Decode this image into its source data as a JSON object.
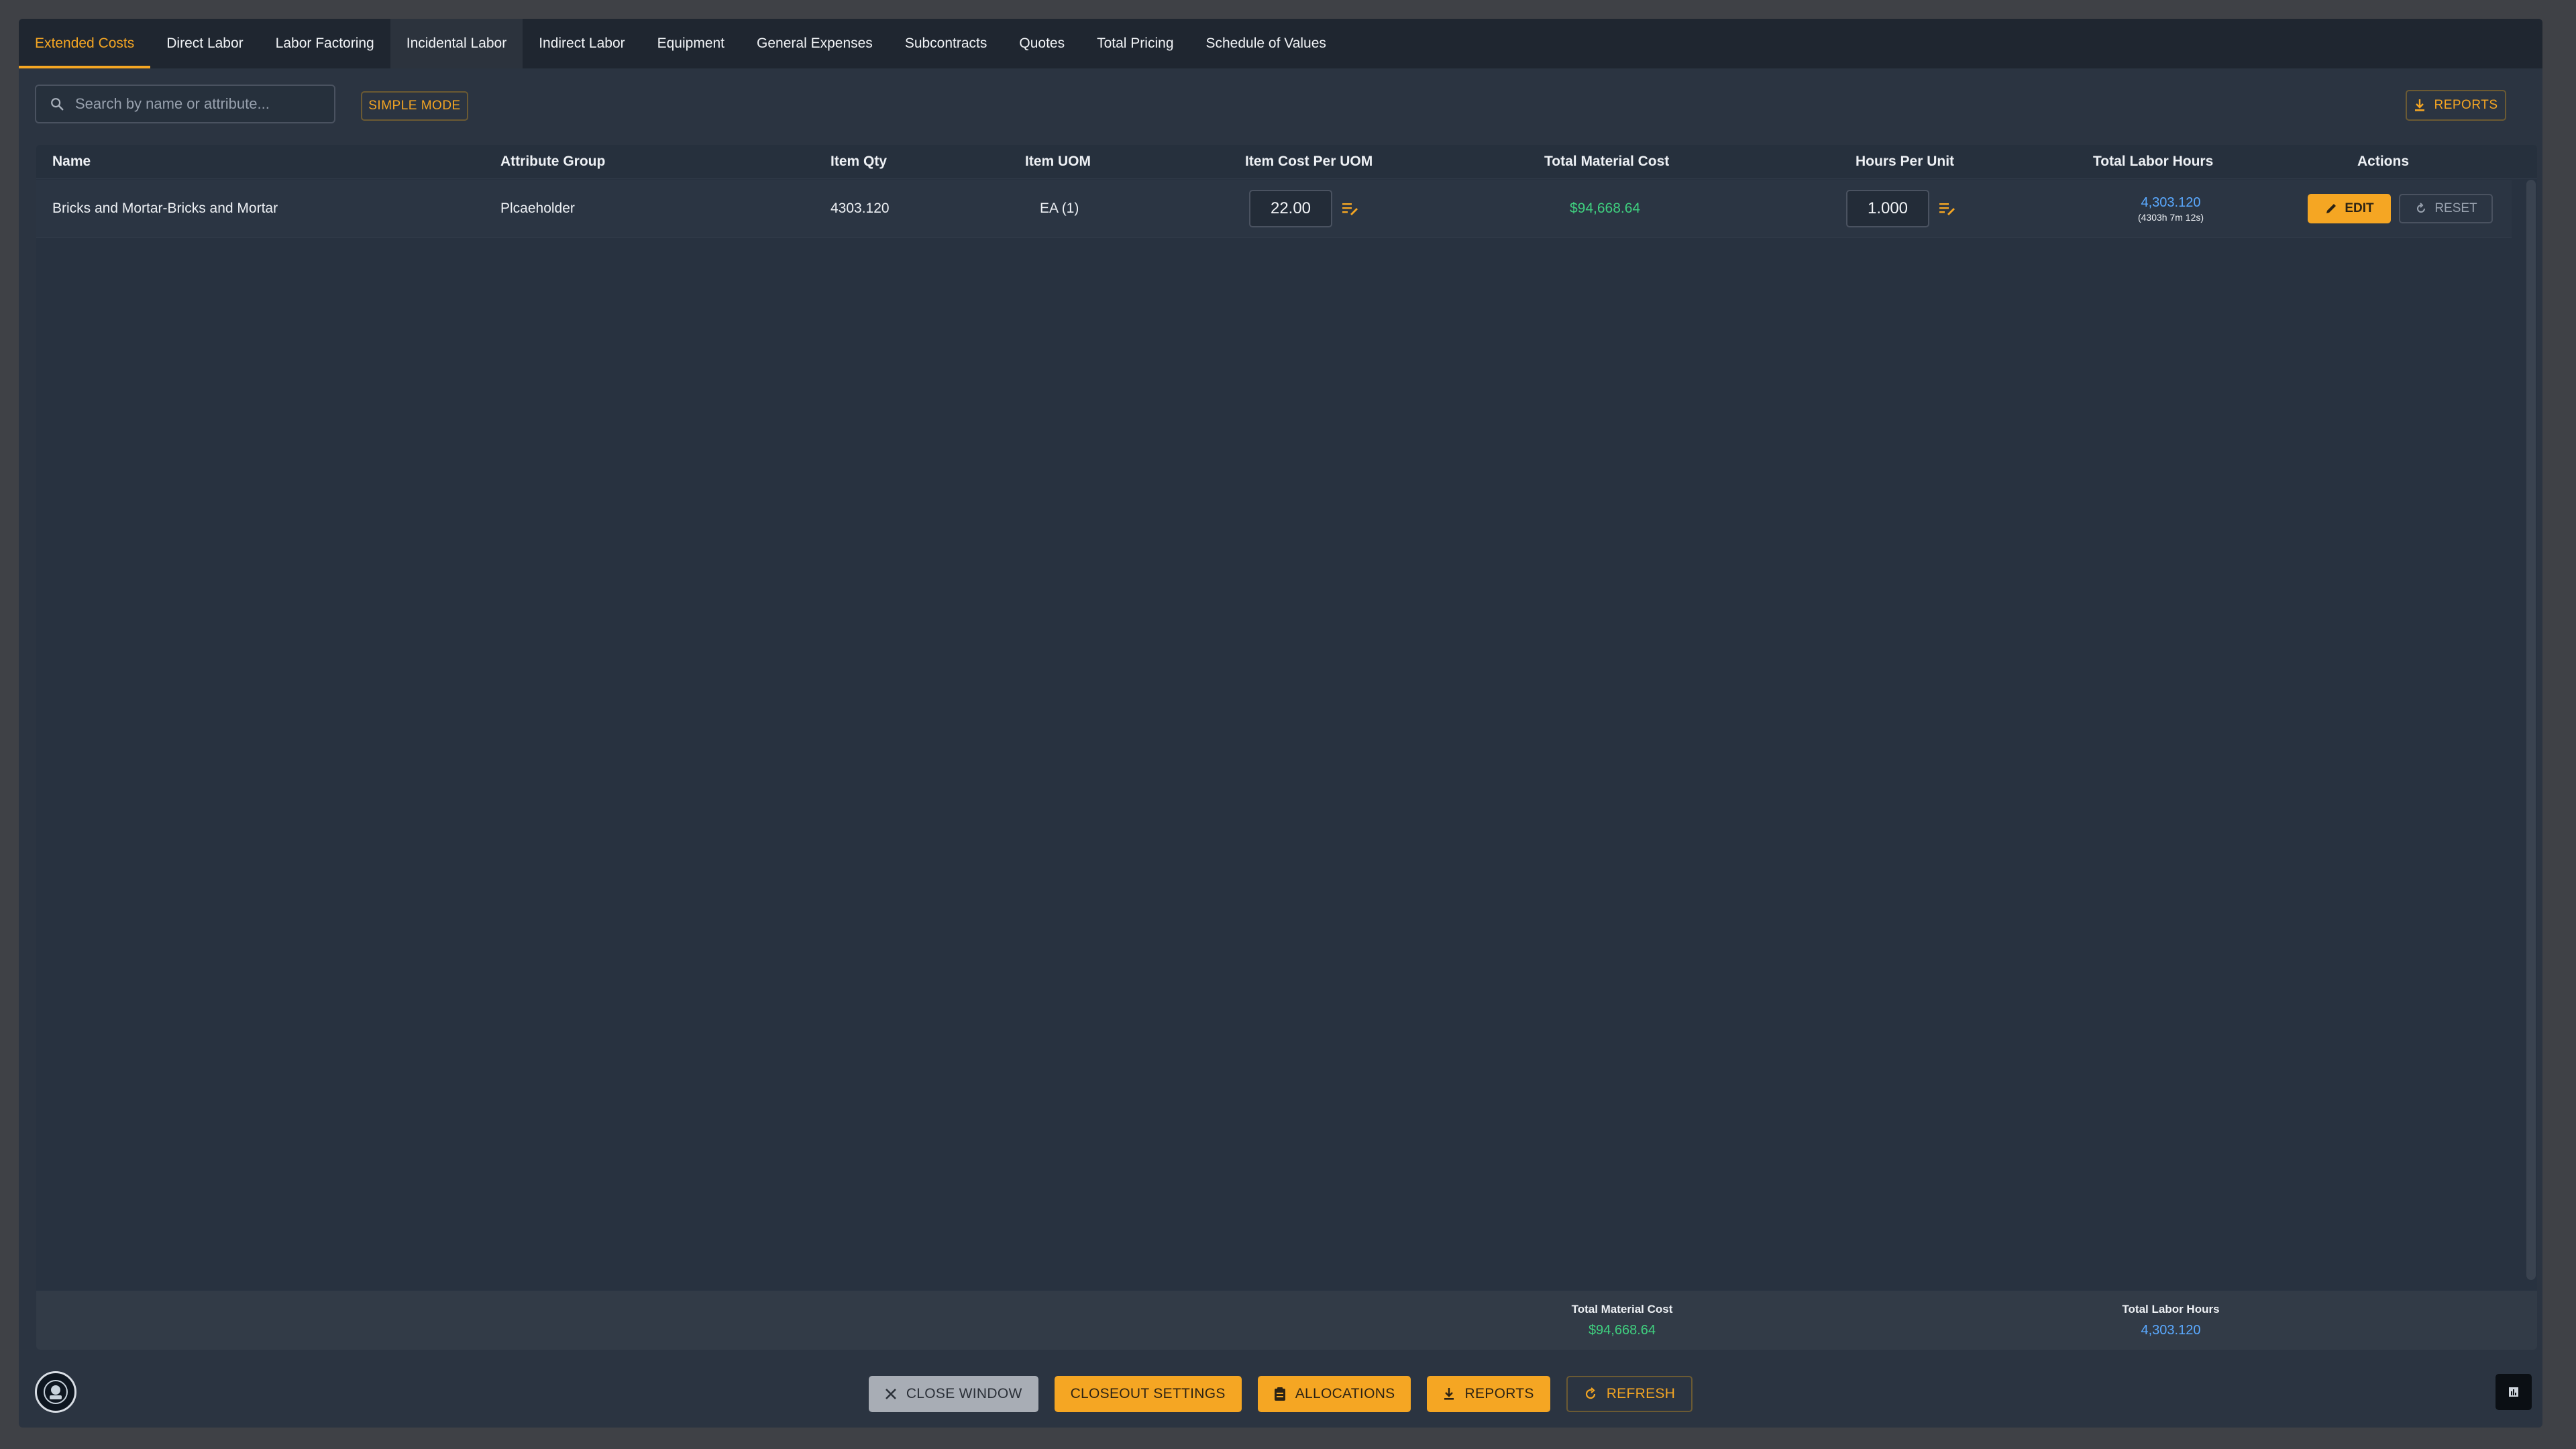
{
  "tabs": [
    {
      "label": "Extended Costs",
      "active": true
    },
    {
      "label": "Direct Labor"
    },
    {
      "label": "Labor Factoring"
    },
    {
      "label": "Incidental Labor"
    },
    {
      "label": "Indirect Labor"
    },
    {
      "label": "Equipment"
    },
    {
      "label": "General Expenses"
    },
    {
      "label": "Subcontracts"
    },
    {
      "label": "Quotes"
    },
    {
      "label": "Total Pricing"
    },
    {
      "label": "Schedule of Values"
    }
  ],
  "toolbar": {
    "search_placeholder": "Search by name or attribute...",
    "simple_mode_label": "SIMPLE MODE",
    "reports_label": "REPORTS"
  },
  "table": {
    "headers": {
      "name": "Name",
      "attribute_group": "Attribute Group",
      "item_qty": "Item Qty",
      "item_uom": "Item UOM",
      "item_cost_per_uom": "Item Cost Per UOM",
      "total_material_cost": "Total Material Cost",
      "hours_per_unit": "Hours Per Unit",
      "total_labor_hours": "Total Labor Hours",
      "actions": "Actions"
    },
    "rows": [
      {
        "name": "Bricks and Mortar-Bricks and Mortar",
        "attribute_group": "Plcaeholder",
        "item_qty": "4303.120",
        "item_uom": "EA (1)",
        "item_cost_per_uom": "22.00",
        "total_material_cost": "$94,668.64",
        "hours_per_unit": "1.000",
        "total_labor_hours": "4,303.120",
        "total_labor_hours_detail": "(4303h 7m 12s)",
        "edit_label": "EDIT",
        "reset_label": "RESET"
      }
    ],
    "footer": {
      "material_label": "Total Material Cost",
      "material_value": "$94,668.64",
      "labor_label": "Total Labor Hours",
      "labor_value": "4,303.120"
    }
  },
  "bottom_bar": {
    "close_label": "CLOSE WINDOW",
    "closeout_label": "CLOSEOUT SETTINGS",
    "allocations_label": "ALLOCATIONS",
    "reports_label": "REPORTS",
    "refresh_label": "REFRESH"
  },
  "colors": {
    "accent": "#f5a623",
    "money": "#3fd07f",
    "hours": "#5aa9ff",
    "background": "#2b3441"
  }
}
